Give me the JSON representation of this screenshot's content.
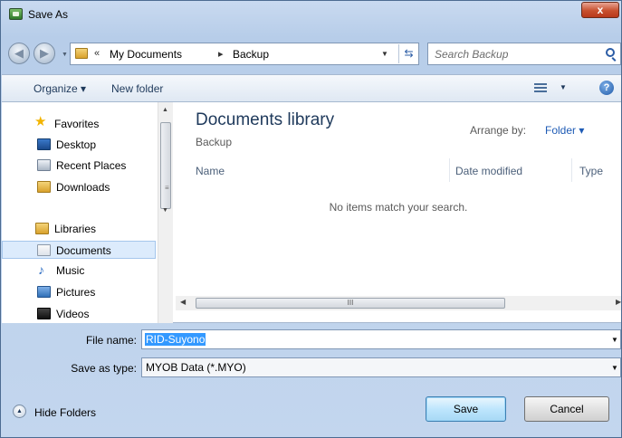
{
  "window": {
    "title": "Save As",
    "close_glyph": "x"
  },
  "address": {
    "overflow_glyph": "«",
    "crumbs": [
      "My Documents",
      "Backup"
    ],
    "separator_glyph": "▸"
  },
  "search": {
    "placeholder": "Search Backup"
  },
  "toolbar": {
    "organize_label": "Organize ▾",
    "new_folder_label": "New folder",
    "help_glyph": "?"
  },
  "nav": {
    "items": [
      {
        "label": "Favorites",
        "icon": "star-icon"
      },
      {
        "label": "Desktop",
        "icon": "desktop-icon"
      },
      {
        "label": "Recent Places",
        "icon": "recent-places-icon"
      },
      {
        "label": "Downloads",
        "icon": "downloads-icon"
      },
      {
        "label": "Libraries",
        "icon": "libraries-icon"
      },
      {
        "label": "Documents",
        "icon": "documents-icon"
      },
      {
        "label": "Music",
        "icon": "music-icon"
      },
      {
        "label": "Pictures",
        "icon": "pictures-icon"
      },
      {
        "label": "Videos",
        "icon": "videos-icon"
      }
    ],
    "selected": "Documents"
  },
  "library": {
    "title": "Documents library",
    "subtitle": "Backup",
    "arrange_label": "Arrange by:",
    "arrange_value": "Folder ▾",
    "columns": [
      "Name",
      "Date modified",
      "Type"
    ],
    "empty_message": "No items match your search.",
    "scroll_grip": "III"
  },
  "fields": {
    "file_name_label": "File name:",
    "file_name_value": "RID-Suyono",
    "save_type_label": "Save as type:",
    "save_type_value": "MYOB Data (*.MYO)"
  },
  "footer": {
    "hide_folders_label": "Hide Folders",
    "save_label": "Save",
    "cancel_label": "Cancel"
  },
  "colors": {
    "accent": "#1e5bb5",
    "selection": "#3399ff",
    "title_text": "#1e395b",
    "close_button": "#c8502f"
  }
}
